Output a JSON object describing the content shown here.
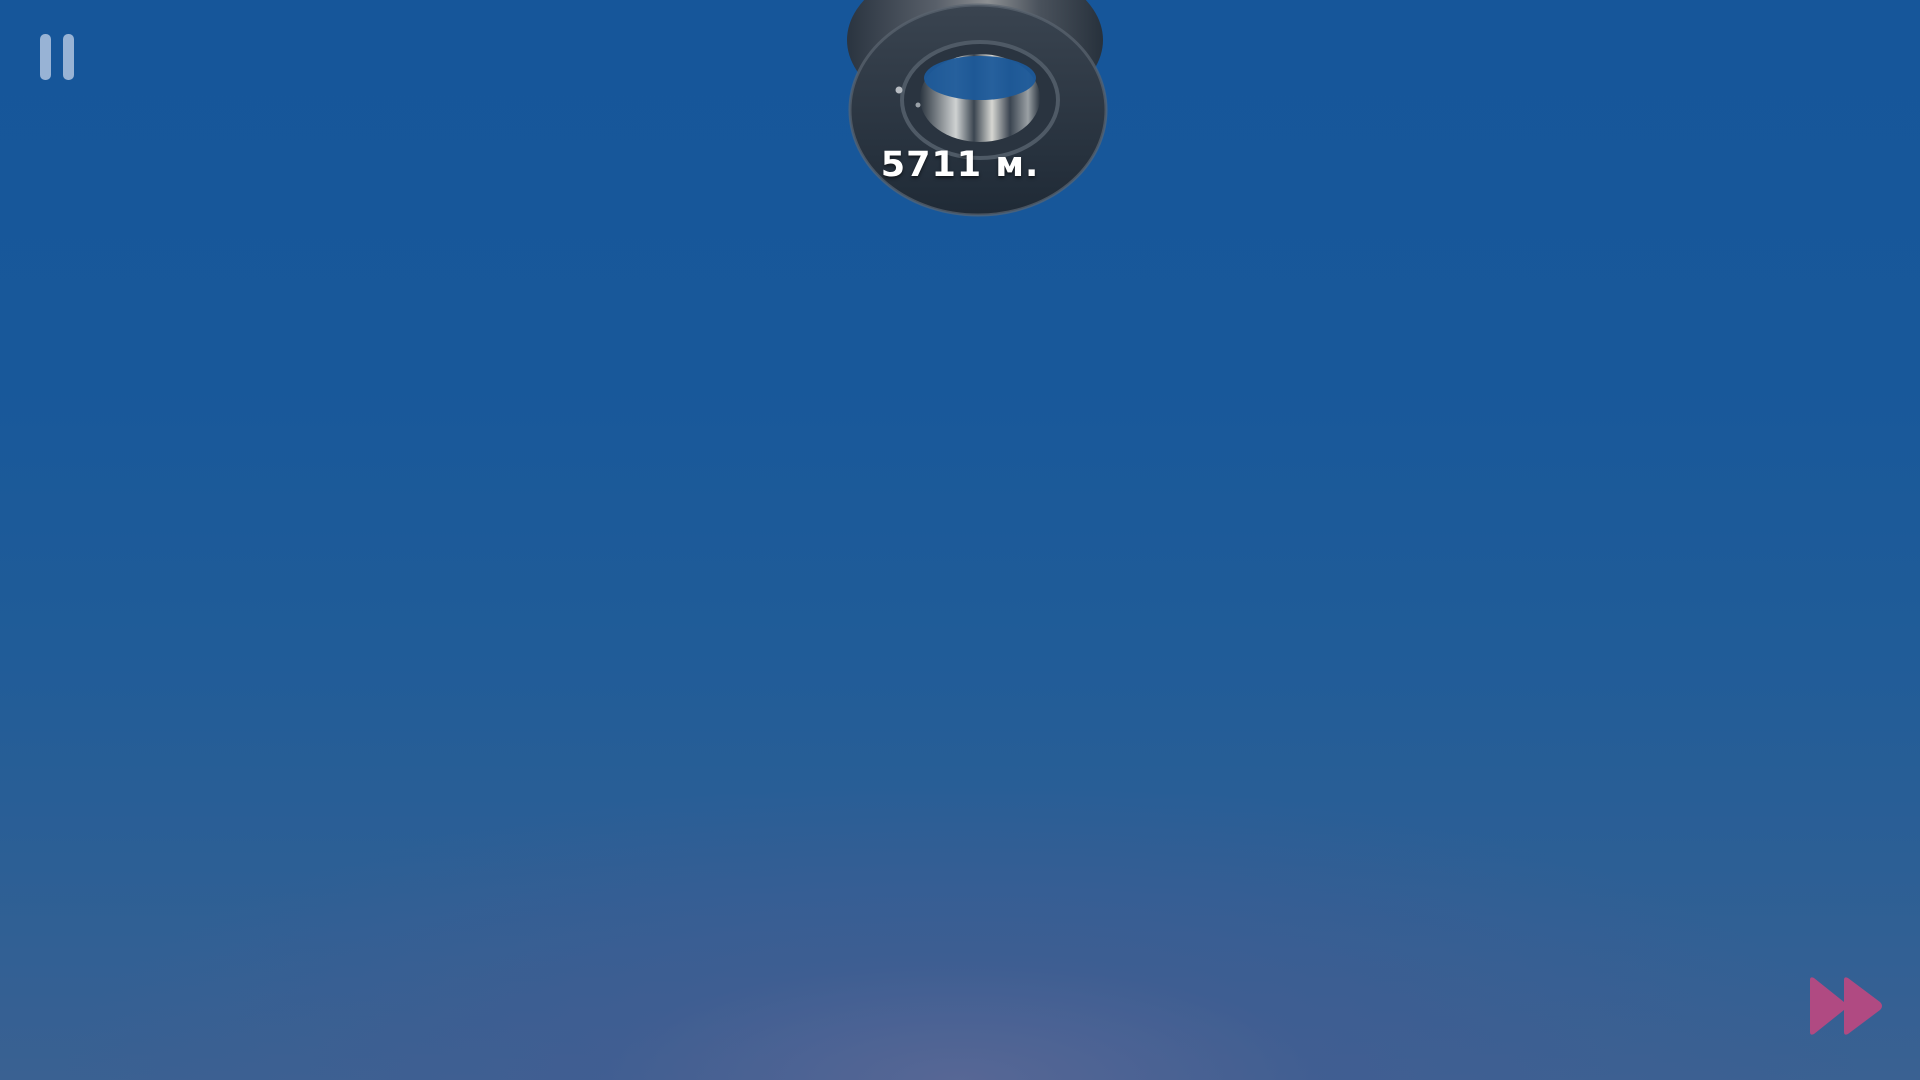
{
  "hud": {
    "distance": "5711 м."
  },
  "icons": {
    "pause": "pause-icon",
    "fast_forward": "fast-forward-icon",
    "tire": "tire-sprite"
  },
  "colors": {
    "sky_top": "#16569a",
    "sky_bottom": "#3a6192",
    "fast_forward": "#b04a82",
    "pause": "#bccde6"
  }
}
